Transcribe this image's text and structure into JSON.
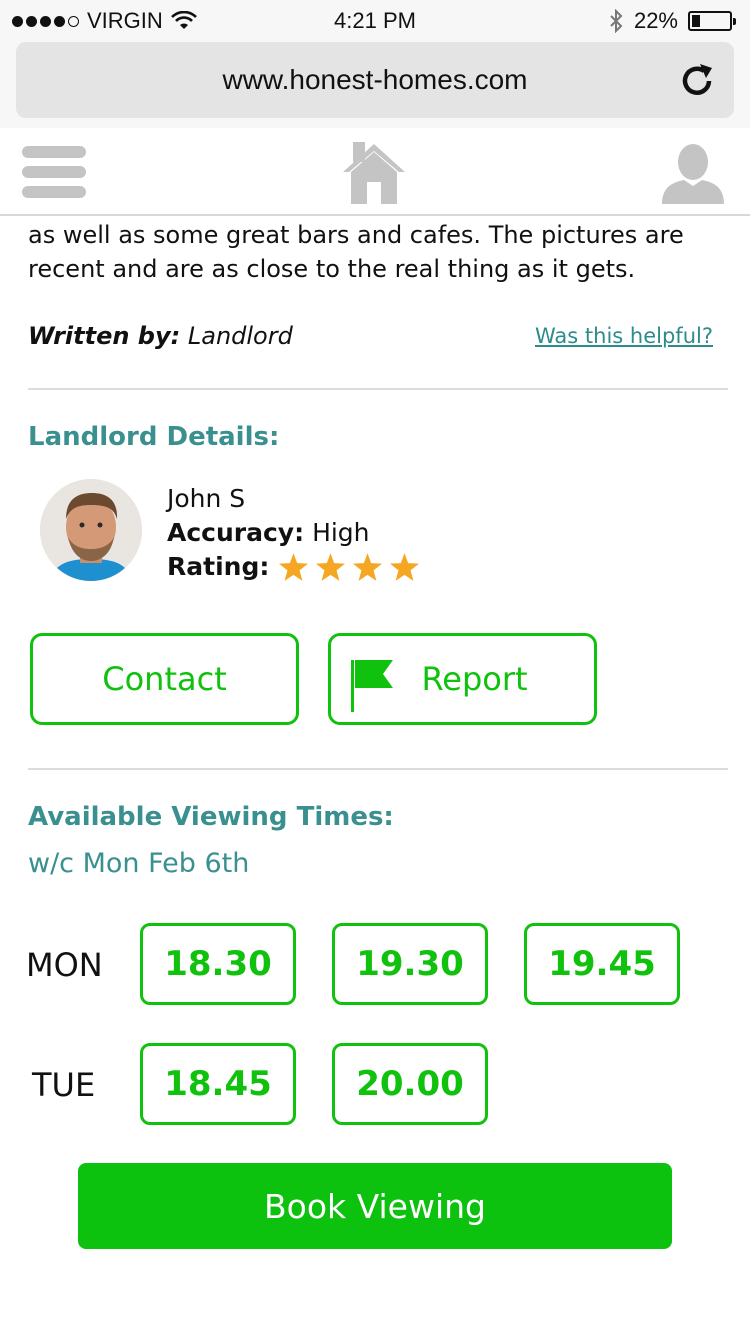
{
  "status_bar": {
    "carrier": "VIRGIN",
    "time": "4:21 PM",
    "battery": "22%",
    "battery_level": 0.22,
    "signal_bars": 4,
    "signal_max": 5,
    "icons": [
      "wifi-icon",
      "bluetooth-icon",
      "battery-icon"
    ]
  },
  "browser": {
    "url": "www.honest-homes.com",
    "icons": [
      "reload-icon"
    ]
  },
  "nav": {
    "icons": [
      "menu-icon",
      "home-icon",
      "user-icon"
    ]
  },
  "review": {
    "text": "as well as some great bars and cafes. The pictures are recent and are as close to the real thing as it gets.",
    "written_by_label": "Written by:",
    "written_by_value": "Landlord",
    "helpful_link": "Was this helpful?"
  },
  "landlord": {
    "section_title": "Landlord Details:",
    "name": "John S",
    "accuracy_label": "Accuracy:",
    "accuracy_value": "High",
    "rating_label": "Rating:",
    "rating_stars": 4,
    "star_color": "#f5a623",
    "contact_label": "Contact",
    "report_label": "Report",
    "icons": [
      "avatar-photo",
      "flag-icon",
      "star-icon"
    ]
  },
  "viewing": {
    "section_title": "Available Viewing Times:",
    "week": "w/c Mon Feb 6th",
    "days": [
      {
        "label": "MON",
        "times": [
          "18.30",
          "19.30",
          "19.45"
        ]
      },
      {
        "label": "TUE",
        "times": [
          "18.45",
          "20.00"
        ]
      }
    ],
    "book_label": "Book Viewing"
  },
  "colors": {
    "accent_green": "#10c10d",
    "teal": "#3a8f8f",
    "link_teal": "#2e8b8b"
  }
}
